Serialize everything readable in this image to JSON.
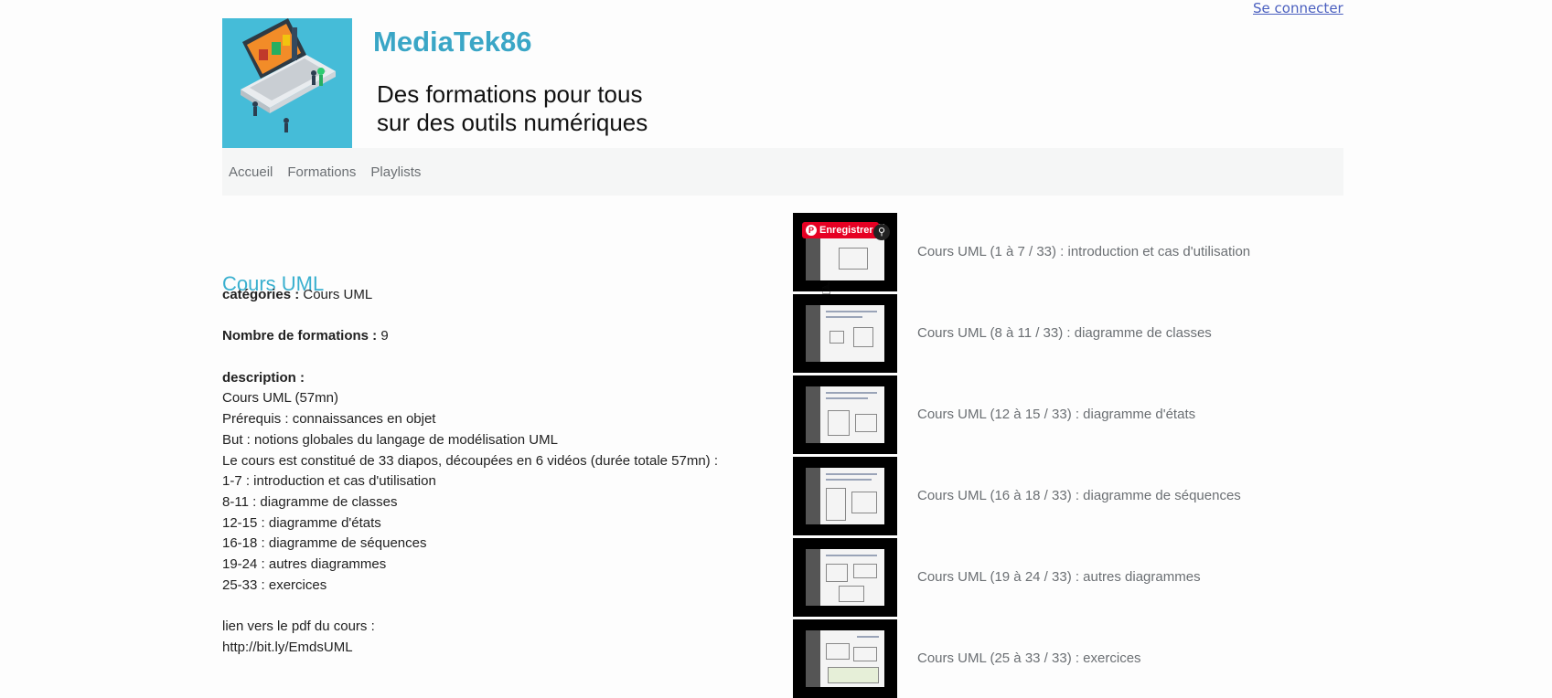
{
  "header": {
    "login_label": "Se connecter",
    "site_title": "MediaTek86",
    "tagline_line1": "Des formations pour tous",
    "tagline_line2": "sur des outils numériques"
  },
  "nav": {
    "items": [
      "Accueil",
      "Formations",
      "Playlists"
    ]
  },
  "playlist": {
    "title": "Cours UML",
    "categories_label": "catégories :",
    "categories_value": "Cours  UML",
    "count_label": "Nombre de formations :",
    "count_value": "9",
    "description_label": "description :",
    "description_lines": [
      "Cours UML (57mn)",
      "Prérequis : connaissances en objet",
      "But : notions globales du langage de modélisation UML",
      "Le cours est constitué de 33 diapos, découpées en 6 vidéos (durée totale 57mn) :",
      "1-7 : introduction et cas d'utilisation",
      "8-11 : diagramme de classes",
      "12-15 : diagramme d'états",
      "16-18 : diagramme de séquences",
      "19-24 : autres diagrammes",
      "25-33 : exercices"
    ],
    "pdf_label": "lien vers le pdf du cours :",
    "pdf_url": "http://bit.ly/EmdsUML"
  },
  "overlay": {
    "save_label": "Enregistrer"
  },
  "videos": [
    {
      "title": "Cours UML (1 à 7 / 33) : introduction et cas d'utilisation"
    },
    {
      "title": "Cours UML (8 à 11 / 33) : diagramme de classes"
    },
    {
      "title": "Cours UML (12 à 15 / 33) : diagramme d'états"
    },
    {
      "title": "Cours UML (16 à 18 / 33) : diagramme de séquences"
    },
    {
      "title": "Cours UML (19 à 24 / 33) : autres diagrammes"
    },
    {
      "title": "Cours UML (25 à 33 / 33) : exercices"
    }
  ],
  "colors": {
    "accent": "#3ab0cf",
    "logo_bg": "#45bcd8",
    "pinterest_red": "#e60023"
  }
}
